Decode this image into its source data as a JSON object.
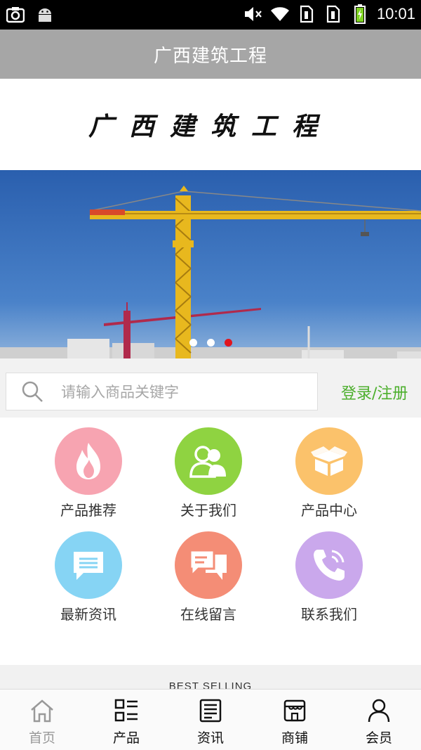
{
  "status_bar": {
    "time": "10:01",
    "left_icons": [
      "screenshot-icon",
      "android-icon"
    ],
    "right_icons": [
      "volume-mute-icon",
      "wifi-icon",
      "sim1-icon",
      "sim2-icon",
      "battery-charging-icon"
    ]
  },
  "header": {
    "title": "广西建筑工程"
  },
  "logo": {
    "text": "广西建筑工程"
  },
  "banner": {
    "slide_count": 3,
    "active_slide": 3,
    "description": "construction tower crane"
  },
  "search": {
    "placeholder": "请输入商品关键字",
    "login_label": "登录/注册"
  },
  "grid": {
    "items": [
      {
        "label": "产品推荐",
        "icon": "flame-icon",
        "color": "#f7a4b1"
      },
      {
        "label": "关于我们",
        "icon": "users-icon",
        "color": "#8fd341"
      },
      {
        "label": "产品中心",
        "icon": "box-icon",
        "color": "#fbc26b"
      },
      {
        "label": "最新资讯",
        "icon": "message-icon",
        "color": "#86d4f4"
      },
      {
        "label": "在线留言",
        "icon": "chat-icon",
        "color": "#f48d76"
      },
      {
        "label": "联系我们",
        "icon": "phone-icon",
        "color": "#caa8ec"
      }
    ]
  },
  "best_selling": {
    "heading": "BEST SELLING"
  },
  "bottom_nav": {
    "items": [
      {
        "label": "首页",
        "icon": "home-icon",
        "active": true
      },
      {
        "label": "产品",
        "icon": "grid-list-icon",
        "active": false
      },
      {
        "label": "资讯",
        "icon": "news-icon",
        "active": false
      },
      {
        "label": "商铺",
        "icon": "store-icon",
        "active": false
      },
      {
        "label": "会员",
        "icon": "user-icon",
        "active": false
      }
    ]
  },
  "colors": {
    "accent_green": "#4caf2c",
    "active_dot": "#e0151e",
    "titlebar_bg": "#a6a6a6"
  }
}
